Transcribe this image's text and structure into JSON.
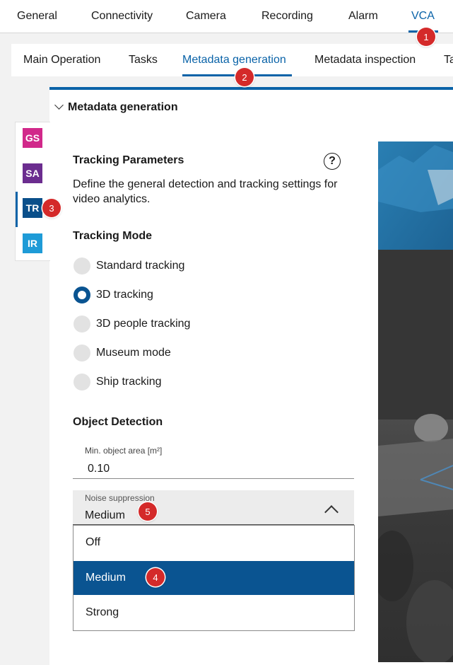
{
  "top_nav": {
    "items": [
      "General",
      "Connectivity",
      "Camera",
      "Recording",
      "Alarm",
      "VCA"
    ],
    "active": "VCA"
  },
  "sub_nav": {
    "items": [
      "Main Operation",
      "Tasks",
      "Metadata generation",
      "Metadata inspection",
      "Ta"
    ],
    "active": "Metadata generation"
  },
  "section": {
    "title": "Metadata generation"
  },
  "side_tabs": [
    {
      "label": "GS",
      "color": "#d1288a"
    },
    {
      "label": "SA",
      "color": "#6b2d8f"
    },
    {
      "label": "TR",
      "color": "#0a4f8a"
    },
    {
      "label": "IR",
      "color": "#1e9bd7"
    }
  ],
  "active_side_tab": "TR",
  "tracking": {
    "title": "Tracking Parameters",
    "help_glyph": "?",
    "description": "Define the general detection and tracking settings for video analytics."
  },
  "tracking_mode": {
    "title": "Tracking Mode",
    "options": [
      "Standard tracking",
      "3D tracking",
      "3D people tracking",
      "Museum mode",
      "Ship tracking"
    ],
    "selected": "3D tracking"
  },
  "object_detection": {
    "title": "Object Detection",
    "min_area": {
      "label": "Min. object area [m²]",
      "value": "0.10"
    },
    "noise": {
      "label": "Noise suppression",
      "value": "Medium",
      "options": [
        "Off",
        "Medium",
        "Strong"
      ],
      "selected": "Medium"
    }
  },
  "markers": [
    "1",
    "2",
    "3",
    "4",
    "5"
  ],
  "colors": {
    "accent": "#0a63a8",
    "selected": "#0a5491",
    "marker": "#d42a2a"
  }
}
